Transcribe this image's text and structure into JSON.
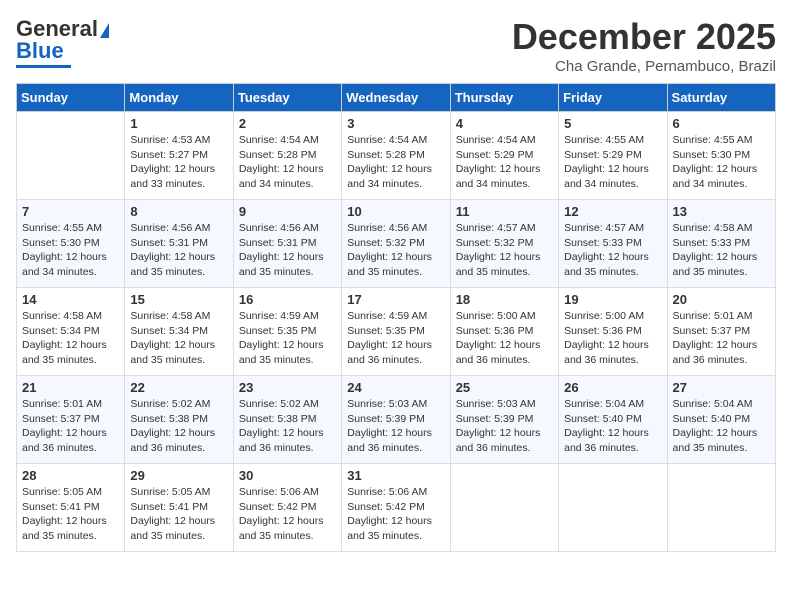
{
  "header": {
    "logo_general": "General",
    "logo_blue": "Blue",
    "month_title": "December 2025",
    "subtitle": "Cha Grande, Pernambuco, Brazil"
  },
  "days_of_week": [
    "Sunday",
    "Monday",
    "Tuesday",
    "Wednesday",
    "Thursday",
    "Friday",
    "Saturday"
  ],
  "weeks": [
    [
      {
        "day": "",
        "info": ""
      },
      {
        "day": "1",
        "info": "Sunrise: 4:53 AM\nSunset: 5:27 PM\nDaylight: 12 hours\nand 33 minutes."
      },
      {
        "day": "2",
        "info": "Sunrise: 4:54 AM\nSunset: 5:28 PM\nDaylight: 12 hours\nand 34 minutes."
      },
      {
        "day": "3",
        "info": "Sunrise: 4:54 AM\nSunset: 5:28 PM\nDaylight: 12 hours\nand 34 minutes."
      },
      {
        "day": "4",
        "info": "Sunrise: 4:54 AM\nSunset: 5:29 PM\nDaylight: 12 hours\nand 34 minutes."
      },
      {
        "day": "5",
        "info": "Sunrise: 4:55 AM\nSunset: 5:29 PM\nDaylight: 12 hours\nand 34 minutes."
      },
      {
        "day": "6",
        "info": "Sunrise: 4:55 AM\nSunset: 5:30 PM\nDaylight: 12 hours\nand 34 minutes."
      }
    ],
    [
      {
        "day": "7",
        "info": "Sunrise: 4:55 AM\nSunset: 5:30 PM\nDaylight: 12 hours\nand 34 minutes."
      },
      {
        "day": "8",
        "info": "Sunrise: 4:56 AM\nSunset: 5:31 PM\nDaylight: 12 hours\nand 35 minutes."
      },
      {
        "day": "9",
        "info": "Sunrise: 4:56 AM\nSunset: 5:31 PM\nDaylight: 12 hours\nand 35 minutes."
      },
      {
        "day": "10",
        "info": "Sunrise: 4:56 AM\nSunset: 5:32 PM\nDaylight: 12 hours\nand 35 minutes."
      },
      {
        "day": "11",
        "info": "Sunrise: 4:57 AM\nSunset: 5:32 PM\nDaylight: 12 hours\nand 35 minutes."
      },
      {
        "day": "12",
        "info": "Sunrise: 4:57 AM\nSunset: 5:33 PM\nDaylight: 12 hours\nand 35 minutes."
      },
      {
        "day": "13",
        "info": "Sunrise: 4:58 AM\nSunset: 5:33 PM\nDaylight: 12 hours\nand 35 minutes."
      }
    ],
    [
      {
        "day": "14",
        "info": "Sunrise: 4:58 AM\nSunset: 5:34 PM\nDaylight: 12 hours\nand 35 minutes."
      },
      {
        "day": "15",
        "info": "Sunrise: 4:58 AM\nSunset: 5:34 PM\nDaylight: 12 hours\nand 35 minutes."
      },
      {
        "day": "16",
        "info": "Sunrise: 4:59 AM\nSunset: 5:35 PM\nDaylight: 12 hours\nand 35 minutes."
      },
      {
        "day": "17",
        "info": "Sunrise: 4:59 AM\nSunset: 5:35 PM\nDaylight: 12 hours\nand 36 minutes."
      },
      {
        "day": "18",
        "info": "Sunrise: 5:00 AM\nSunset: 5:36 PM\nDaylight: 12 hours\nand 36 minutes."
      },
      {
        "day": "19",
        "info": "Sunrise: 5:00 AM\nSunset: 5:36 PM\nDaylight: 12 hours\nand 36 minutes."
      },
      {
        "day": "20",
        "info": "Sunrise: 5:01 AM\nSunset: 5:37 PM\nDaylight: 12 hours\nand 36 minutes."
      }
    ],
    [
      {
        "day": "21",
        "info": "Sunrise: 5:01 AM\nSunset: 5:37 PM\nDaylight: 12 hours\nand 36 minutes."
      },
      {
        "day": "22",
        "info": "Sunrise: 5:02 AM\nSunset: 5:38 PM\nDaylight: 12 hours\nand 36 minutes."
      },
      {
        "day": "23",
        "info": "Sunrise: 5:02 AM\nSunset: 5:38 PM\nDaylight: 12 hours\nand 36 minutes."
      },
      {
        "day": "24",
        "info": "Sunrise: 5:03 AM\nSunset: 5:39 PM\nDaylight: 12 hours\nand 36 minutes."
      },
      {
        "day": "25",
        "info": "Sunrise: 5:03 AM\nSunset: 5:39 PM\nDaylight: 12 hours\nand 36 minutes."
      },
      {
        "day": "26",
        "info": "Sunrise: 5:04 AM\nSunset: 5:40 PM\nDaylight: 12 hours\nand 36 minutes."
      },
      {
        "day": "27",
        "info": "Sunrise: 5:04 AM\nSunset: 5:40 PM\nDaylight: 12 hours\nand 35 minutes."
      }
    ],
    [
      {
        "day": "28",
        "info": "Sunrise: 5:05 AM\nSunset: 5:41 PM\nDaylight: 12 hours\nand 35 minutes."
      },
      {
        "day": "29",
        "info": "Sunrise: 5:05 AM\nSunset: 5:41 PM\nDaylight: 12 hours\nand 35 minutes."
      },
      {
        "day": "30",
        "info": "Sunrise: 5:06 AM\nSunset: 5:42 PM\nDaylight: 12 hours\nand 35 minutes."
      },
      {
        "day": "31",
        "info": "Sunrise: 5:06 AM\nSunset: 5:42 PM\nDaylight: 12 hours\nand 35 minutes."
      },
      {
        "day": "",
        "info": ""
      },
      {
        "day": "",
        "info": ""
      },
      {
        "day": "",
        "info": ""
      }
    ]
  ]
}
